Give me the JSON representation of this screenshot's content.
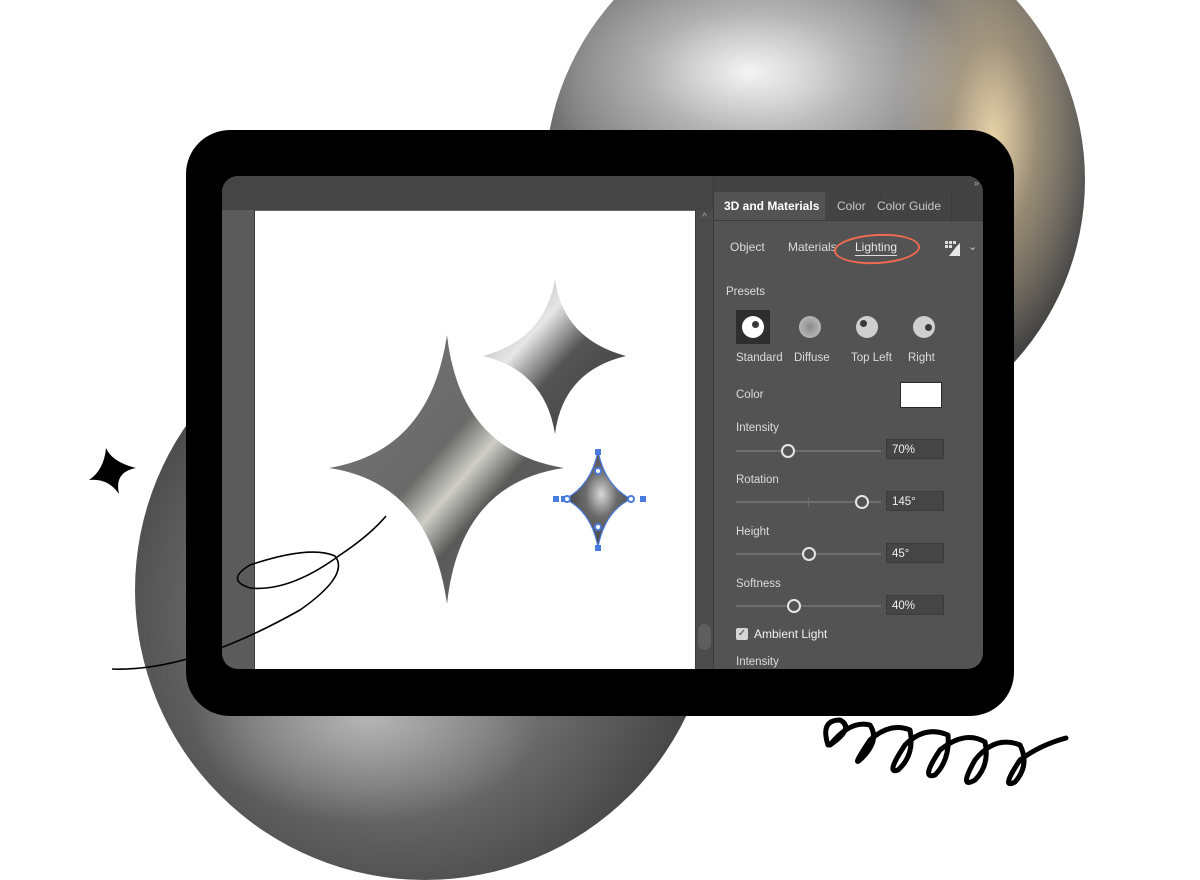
{
  "panel": {
    "tabs": [
      {
        "label": "3D and Materials",
        "active": true
      },
      {
        "label": "Color",
        "active": false
      },
      {
        "label": "Color Guide",
        "active": false
      }
    ],
    "subtabs": [
      {
        "label": "Object",
        "active": false
      },
      {
        "label": "Materials",
        "active": false
      },
      {
        "label": "Lighting",
        "active": true
      }
    ],
    "highlight_color": "#f26a50",
    "presets_title": "Presets",
    "presets": [
      {
        "label": "Standard",
        "selected": true
      },
      {
        "label": "Diffuse",
        "selected": false
      },
      {
        "label": "Top Left",
        "selected": false
      },
      {
        "label": "Right",
        "selected": false
      }
    ],
    "color_label": "Color",
    "color_value": "#ffffff",
    "sliders": [
      {
        "label": "Intensity",
        "value": "70%",
        "fraction": 0.36
      },
      {
        "label": "Rotation",
        "value": "145°",
        "fraction": 0.87
      },
      {
        "label": "Height",
        "value": "45°",
        "fraction": 0.5
      },
      {
        "label": "Softness",
        "value": "40%",
        "fraction": 0.4
      }
    ],
    "ambient_light": {
      "label": "Ambient Light",
      "checked": true
    },
    "ambient_intensity_label": "Intensity"
  },
  "icons": {
    "collapse": "»",
    "scroll_up": "^",
    "chevron": "⌄",
    "check": "✓"
  },
  "canvas": {
    "objects": [
      "large-sparkle",
      "medium-sparkle",
      "small-selected-sparkle"
    ],
    "selection_color": "#4a7be0"
  }
}
